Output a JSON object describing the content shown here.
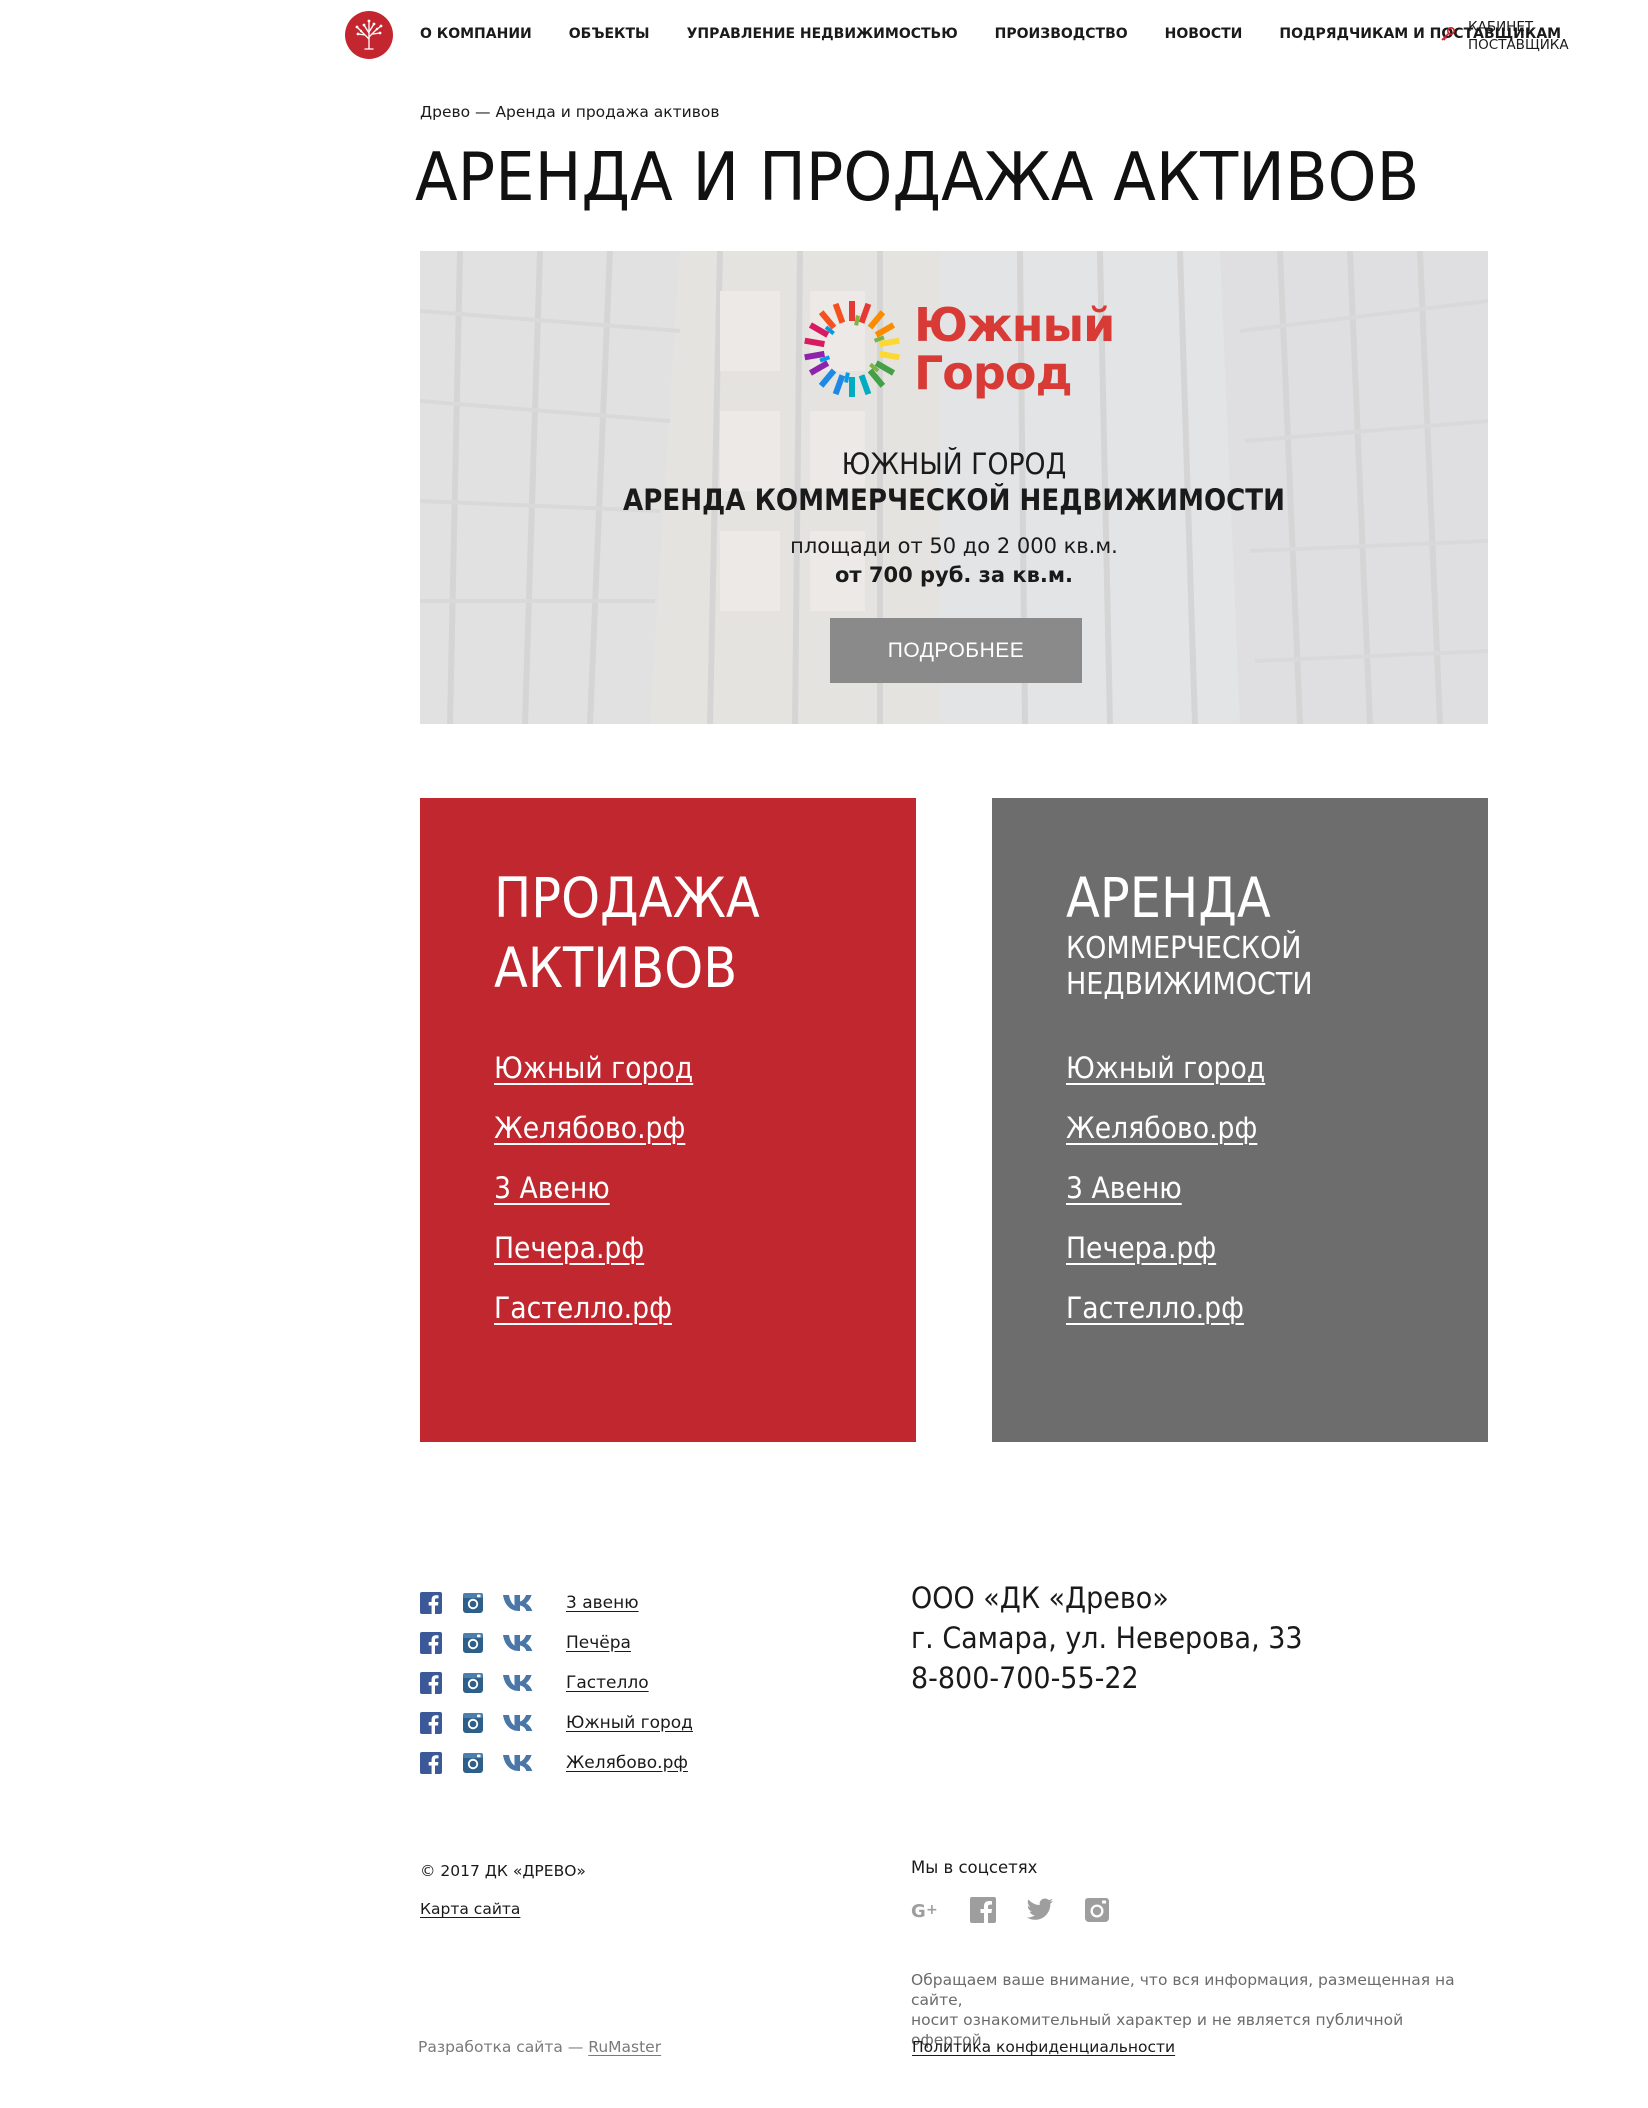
{
  "header": {
    "nav": [
      {
        "label": "О КОМПАНИИ"
      },
      {
        "label": "ОБЪЕКТЫ"
      },
      {
        "label": "УПРАВЛЕНИЕ НЕДВИЖИМОСТЬЮ"
      },
      {
        "label": "ПРОИЗВОДСТВО"
      },
      {
        "label": "НОВОСТИ"
      },
      {
        "label": "ПОДРЯДЧИКАМ И ПОСТАВЩИКАМ"
      }
    ],
    "cabinet_line1": "КАБИНЕТ",
    "cabinet_line2": "ПОСТАВЩИКА",
    "brand_color": "#c4262f"
  },
  "breadcrumb": "Древо — Аренда и продажа активов",
  "page_title": "АРЕНДА И ПРОДАЖА АКТИВОВ",
  "banner": {
    "logo_line1": "Южный",
    "logo_line2": "Город",
    "line1": "ЮЖНЫЙ ГОРОД",
    "line2": "АРЕНДА КОММЕРЧЕСКОЙ НЕДВИЖИМОСТИ",
    "line3": "площади от 50 до 2 000 кв.м.",
    "line4": "от 700 руб. за кв.м.",
    "button": "ПОДРОБНЕЕ"
  },
  "sale_card": {
    "title_line1": "ПРОДАЖА",
    "title_line2": "АКТИВОВ",
    "links": [
      "Южный город",
      "Желябово.рф",
      "3 Авеню",
      "Печера.рф",
      "Гастелло.рф"
    ],
    "color": "#c0272f"
  },
  "rent_card": {
    "title": "АРЕНДА",
    "subtitle_line1": "КОММЕРЧЕСКОЙ",
    "subtitle_line2": "НЕДВИЖИМОСТИ",
    "links": [
      "Южный город",
      "Желябово.рф",
      "3 Авеню",
      "Печера.рф",
      "Гастелло.рф"
    ],
    "color": "#6d6d6d"
  },
  "footer": {
    "projects": [
      "3 авеню",
      "Печёра",
      "Гастелло",
      "Южный город",
      "Желябово.рф"
    ],
    "company_name": "ООО «ДК «Древо»",
    "address": "г. Самара, ул. Неверова, 33",
    "phone": "8-800-700-55-22",
    "copyright": "© 2017 ДК «ДРЕВО»",
    "sitemap": "Карта сайта",
    "developer_prefix": "Разработка сайта — ",
    "developer_link": "RuMaster",
    "social_heading": "Мы в соцсетях",
    "social_icons": [
      "google-plus-icon",
      "facebook-icon",
      "twitter-icon",
      "instagram-icon"
    ],
    "notice_line1": "Обращаем ваше внимание, что вся информация, размещенная на сайте,",
    "notice_line2": "носит ознакомительный характер и не является публичной офертой.",
    "privacy": "Политика конфиденциальности"
  }
}
